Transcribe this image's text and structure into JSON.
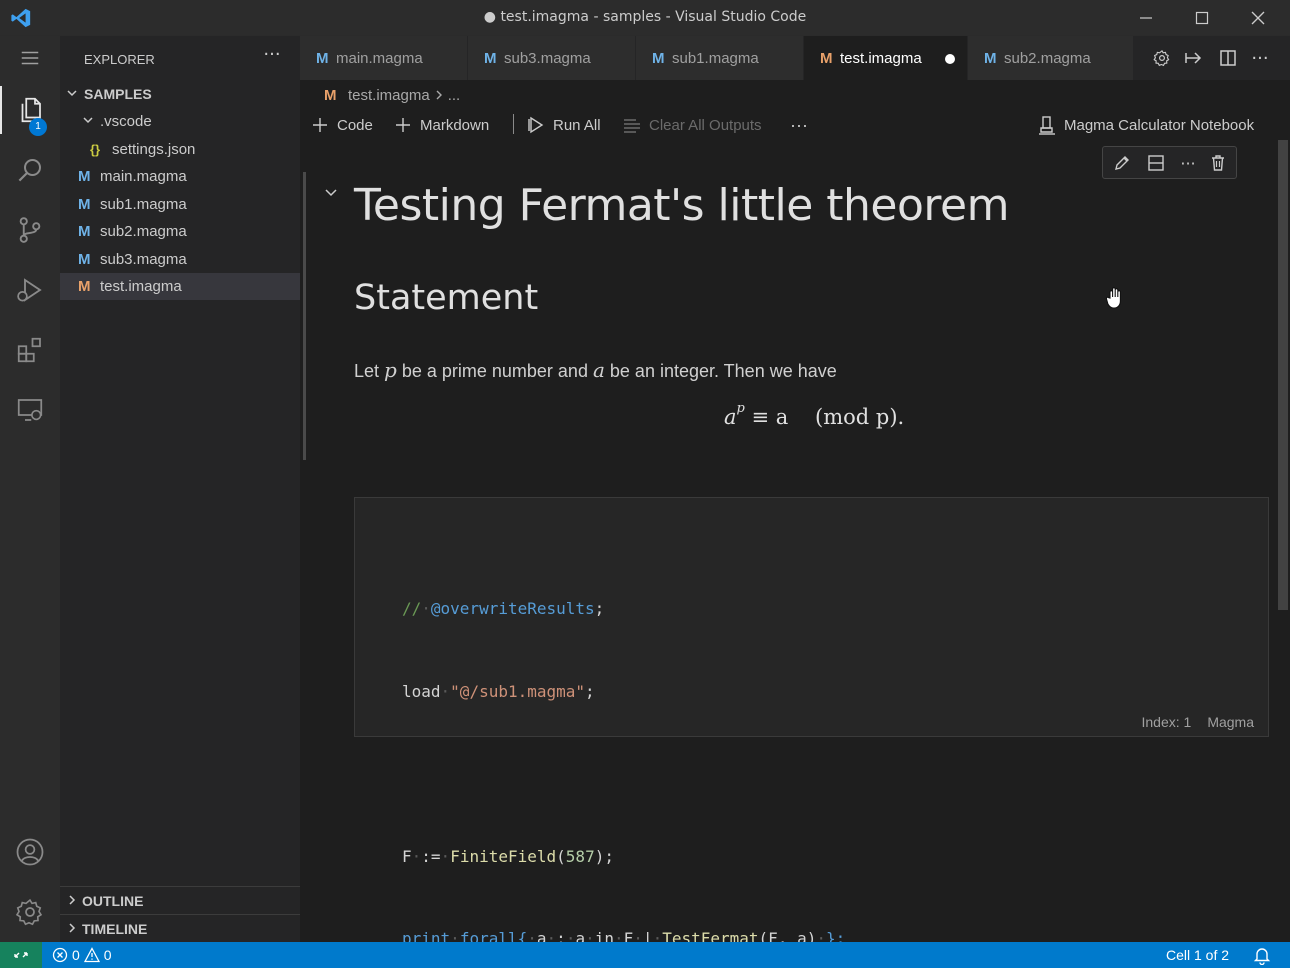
{
  "window": {
    "title": "● test.imagma - samples - Visual Studio Code"
  },
  "activity_bar": {
    "explorer_badge": "1"
  },
  "sidebar": {
    "header": "EXPLORER",
    "more": "···",
    "root": "SAMPLES",
    "folder": ".vscode",
    "settings_file": "settings.json",
    "files": [
      "main.magma",
      "sub1.magma",
      "sub2.magma",
      "sub3.magma",
      "test.imagma"
    ],
    "outline": "OUTLINE",
    "timeline": "TIMELINE"
  },
  "tabs": [
    {
      "label": "main.magma"
    },
    {
      "label": "sub3.magma"
    },
    {
      "label": "sub1.magma"
    },
    {
      "label": "test.imagma"
    },
    {
      "label": "sub2.magma"
    }
  ],
  "breadcrumb": {
    "file": "test.imagma",
    "more": "..."
  },
  "notebook_toolbar": {
    "code": "Code",
    "markdown": "Markdown",
    "run_all": "Run All",
    "clear_outputs": "Clear All Outputs",
    "more": "···",
    "kernel": "Magma Calculator Notebook"
  },
  "markdown_cell": {
    "h1": "Testing Fermat's little theorem",
    "h2": "Statement",
    "p_before": "Let ",
    "p_var1": "p",
    "p_mid": " be a prime number and ",
    "p_var2": "a",
    "p_after": " be an integer. Then we have",
    "math_base": "a",
    "math_exp": "p",
    "math_rest": " ≡ a    (mod p)."
  },
  "code_cell": {
    "line1_comment": "//",
    "line1_decorator": "@overwriteResults",
    "line1_end": ";",
    "line2_kw": "load",
    "line2_str": "\"@/sub1.magma\"",
    "line2_end": ";",
    "line4_var": "F",
    "line4_op": ":=",
    "line4_fn": "FiniteField",
    "line4_num": "587",
    "line5_print": "print",
    "line5_forall": "forall{",
    "line5_a1": "a",
    "line5_colon": ":",
    "line5_a2": "a",
    "line5_in": "in",
    "line5_F": "F",
    "line5_bar": "|",
    "line5_fn": "TestFermat",
    "line5_args": "(F, a)",
    "line5_close": "};",
    "index_label": "Index: 1",
    "language": "Magma"
  },
  "status_bar": {
    "errors": "0",
    "warnings": "0",
    "cell_position": "Cell 1 of 2"
  },
  "colors": {
    "accent": "#007acc",
    "remote": "#16825d",
    "magma_icon": "#6fb3e8",
    "imagma_icon": "#e8a16a"
  }
}
